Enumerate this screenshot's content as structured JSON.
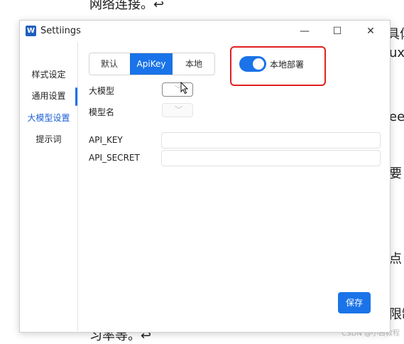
{
  "background": {
    "top_line": "网络连接。↩",
    "bottom_line": "习率等。↩",
    "right_fragments": [
      "具体",
      "ux",
      "eep",
      "要",
      "点",
      "限制"
    ],
    "faint_symbols": "X  ↗"
  },
  "watermark": "CSDN @小白教程",
  "window": {
    "title": "Settiings",
    "app_icon_letter": "W",
    "controls": {
      "minimize": "—",
      "maximize": "☐",
      "close": "✕"
    }
  },
  "sidebar": {
    "items": [
      {
        "label": "样式设定",
        "active": false
      },
      {
        "label": "通用设置",
        "active": false
      },
      {
        "label": "大模型设置",
        "active": true
      },
      {
        "label": "提示词",
        "active": false
      }
    ]
  },
  "tabs": [
    {
      "label": "默认",
      "active": false
    },
    {
      "label": "ApiKey",
      "active": true
    },
    {
      "label": "本地",
      "active": false
    }
  ],
  "local_deploy": {
    "label": "本地部署",
    "enabled": true
  },
  "form": {
    "model_label": "大模型",
    "model_name_label": "模型名",
    "api_key_label": "API_KEY",
    "api_secret_label": "API_SECRET",
    "api_key_value": "",
    "api_secret_value": ""
  },
  "save_label": "保存",
  "colors": {
    "accent": "#1a73e8",
    "highlight": "#e02020"
  }
}
